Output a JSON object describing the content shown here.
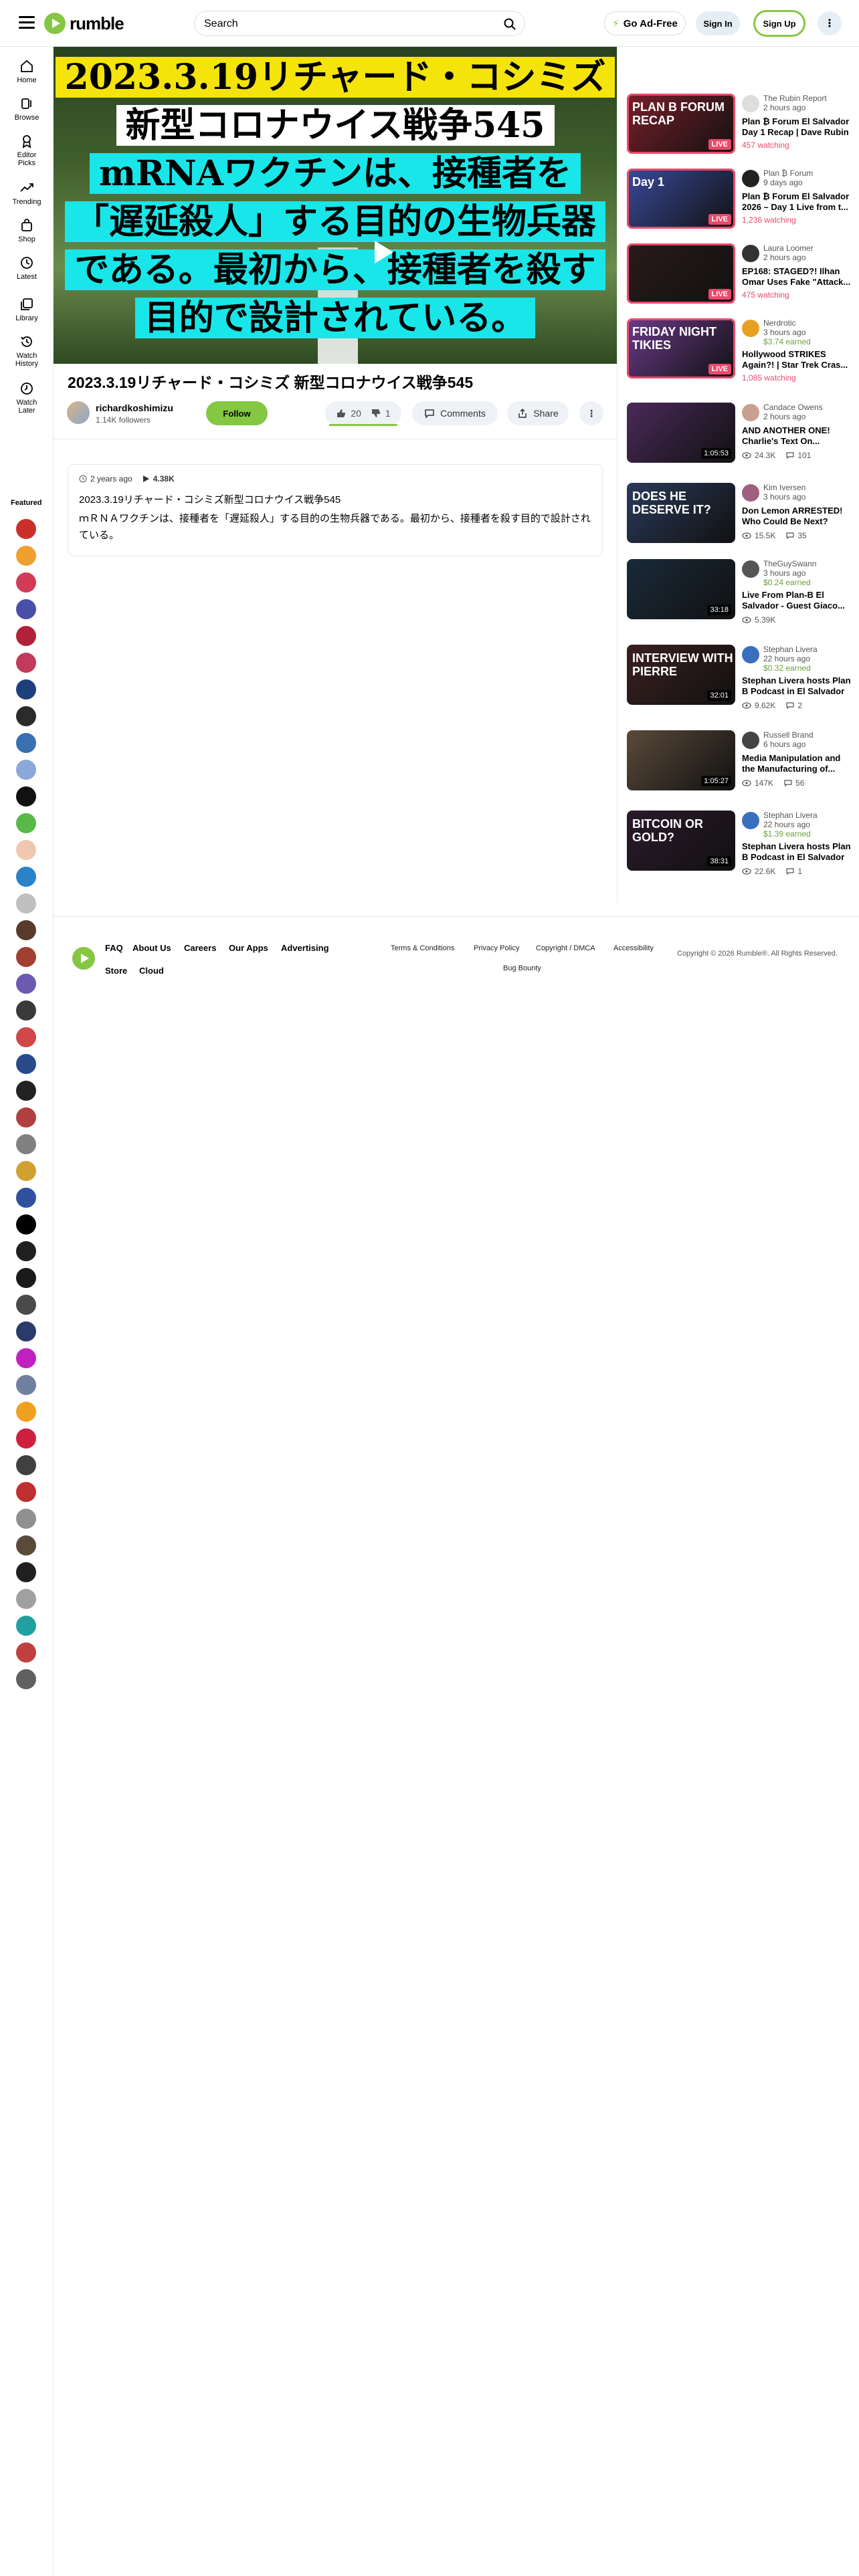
{
  "header": {
    "logo": "rumble",
    "search_placeholder": "Search",
    "go_adfree": "Go Ad-Free",
    "sign_in": "Sign In",
    "sign_up": "Sign Up"
  },
  "sidebar": {
    "items": [
      {
        "label": "Home",
        "icon": "home-icon"
      },
      {
        "label": "Browse",
        "icon": "browse-icon"
      },
      {
        "label": "Editor Picks",
        "icon": "award-icon"
      },
      {
        "label": "Trending",
        "icon": "trending-icon"
      },
      {
        "label": "Shop",
        "icon": "shop-icon"
      },
      {
        "label": "Latest",
        "icon": "clock-icon"
      },
      {
        "label": "Library",
        "icon": "library-icon"
      },
      {
        "label": "Watch History",
        "icon": "history-icon"
      },
      {
        "label": "Watch Later",
        "icon": "watch-later-icon"
      }
    ],
    "featured_title": "Featured",
    "featured_colors": [
      "#c9302c",
      "#f0a030",
      "#d23b58",
      "#4a4fa8",
      "#b2213a",
      "#c23a5c",
      "#1d3f7a",
      "#2b2b2b",
      "#3a6fb0",
      "#8ba8d8",
      "#111111",
      "#58b947",
      "#f0c8b0",
      "#2a82c9",
      "#c0c0c0",
      "#5a3a2a",
      "#a04030",
      "#6a5ab0",
      "#3a3a3a",
      "#d04848",
      "#2a4a8a",
      "#222222",
      "#b04040",
      "#808080",
      "#d0a030",
      "#3050a0",
      "#000000",
      "#202020",
      "#1a1a1a",
      "#4a4a4a",
      "#2a3a6a",
      "#c020c0",
      "#7080a0",
      "#f0a020",
      "#d02040",
      "#404040",
      "#c03030",
      "#909090",
      "#5a4a3a",
      "#202020",
      "#a0a0a0",
      "#20a0a0",
      "#c04040",
      "#606060"
    ]
  },
  "video": {
    "thumb_lines": [
      "2023.3.19リチャード・コシミズ",
      "新型コロナウイス戦争545",
      "mRNAワクチンは、接種者を",
      "「遅延殺人」する目的の生物兵器",
      "である。最初から、接種者を殺す",
      "目的で設計されている。"
    ],
    "title": "2023.3.19リチャード・コシミズ 新型コロナウイス戦争545",
    "channel": "richardkoshimizu",
    "followers": "1.14K followers",
    "follow": "Follow",
    "likes": "20",
    "dislikes": "1",
    "like_fraction": 0.95,
    "comments": "Comments",
    "share": "Share",
    "posted": "2 years ago",
    "views": "4.38K",
    "desc_title": "2023.3.19リチャード・コシミズ新型コロナウイス戦争545",
    "desc_body": "ｍＲＮＡワクチンは、接種者を「遅延殺人」する目的の生物兵器である。最初から、接種者を殺す目的で設計されている。"
  },
  "related": [
    {
      "channel": "The Rubin Report",
      "ago": "2 hours ago",
      "earned": "",
      "title": "Plan ₿ Forum El Salvador Day 1 Recap | Dave Rubin",
      "watching": "457 watching",
      "views": "",
      "comments": "",
      "badge": "LIVE",
      "thumb_text": "PLAN B FORUM RECAP",
      "thumb_color": "#7a1f2a",
      "av": "#ddd"
    },
    {
      "channel": "Plan ₿ Forum",
      "ago": "9 days ago",
      "earned": "",
      "title": "Plan ₿ Forum El Salvador 2026 – Day 1 Live from t...",
      "watching": "1,236 watching",
      "views": "",
      "comments": "",
      "badge": "LIVE",
      "thumb_text": "Day 1",
      "thumb_color": "#3a4a9a",
      "av": "#222"
    },
    {
      "channel": "Laura Loomer",
      "ago": "2 hours ago",
      "earned": "",
      "title": "EP168: STAGED?! Ilhan Omar Uses Fake \"Attack...",
      "watching": "475 watching",
      "views": "",
      "comments": "",
      "badge": "LIVE",
      "thumb_text": "",
      "thumb_color": "#2a1a1a",
      "av": "#333"
    },
    {
      "channel": "Nerdrotic",
      "ago": "3 hours ago",
      "earned": "$3.74 earned",
      "title": "Hollywood STRIKES Again?! | Star Trek Cras...",
      "watching": "1,085 watching",
      "views": "",
      "comments": "",
      "badge": "LIVE",
      "thumb_text": "FRIDAY NIGHT TIKIES",
      "thumb_color": "#6a3a8a",
      "av": "#e8a020"
    },
    {
      "channel": "Candace Owens",
      "ago": "2 hours ago",
      "earned": "",
      "title": "AND ANOTHER ONE! Charlie's Text On...",
      "watching": "",
      "views": "24.3K",
      "comments": "101",
      "badge": "1:05:53",
      "thumb_text": "",
      "thumb_color": "#4a2a5a",
      "av": "#c8a090"
    },
    {
      "channel": "Kim Iversen",
      "ago": "3 hours ago",
      "earned": "",
      "title": "Don Lemon ARRESTED! Who Could Be Next?",
      "watching": "",
      "views": "15.5K",
      "comments": "35",
      "badge": "",
      "thumb_text": "DOES HE DESERVE IT?",
      "thumb_color": "#2a3a5a",
      "av": "#a06080"
    },
    {
      "channel": "TheGuySwann",
      "ago": "3 hours ago",
      "earned": "$0.24 earned",
      "title": "Live From Plan-B El Salvador - Guest Giaco...",
      "watching": "",
      "views": "5.39K",
      "comments": "",
      "badge": "33:18",
      "thumb_text": "",
      "thumb_color": "#1a2a3a",
      "av": "#555"
    },
    {
      "channel": "Stephan Livera",
      "ago": "22 hours ago",
      "earned": "$0.32 earned",
      "title": "Stephan Livera hosts Plan B Podcast in El Salvador",
      "watching": "",
      "views": "9.62K",
      "comments": "2",
      "badge": "32:01",
      "thumb_text": "INTERVIEW WITH PIERRE",
      "thumb_color": "#3a2020",
      "av": "#3a6fc0"
    },
    {
      "channel": "Russell Brand",
      "ago": "6 hours ago",
      "earned": "",
      "title": "Media Manipulation and the Manufacturing of...",
      "watching": "",
      "views": "147K",
      "comments": "56",
      "badge": "1:05:27",
      "thumb_text": "",
      "thumb_color": "#5a4a3a",
      "av": "#444"
    },
    {
      "channel": "Stephan Livera",
      "ago": "22 hours ago",
      "earned": "$1.39 earned",
      "title": "Stephan Livera hosts Plan B Podcast in El Salvador",
      "watching": "",
      "views": "22.6K",
      "comments": "1",
      "badge": "38:31",
      "thumb_text": "BITCOIN OR GOLD?",
      "thumb_color": "#2a1a2a",
      "av": "#3a6fc0"
    }
  ],
  "footer": {
    "links": [
      "FAQ",
      "About Us",
      "Careers",
      "Our Apps",
      "Advertising",
      "Store",
      "Cloud"
    ],
    "small_links": [
      "Terms & Conditions",
      "Privacy Policy",
      "Copyright / DMCA",
      "Accessibility",
      "Bug Bounty"
    ],
    "copyright": "Copyright © 2026 Rumble®. All Rights Reserved."
  }
}
